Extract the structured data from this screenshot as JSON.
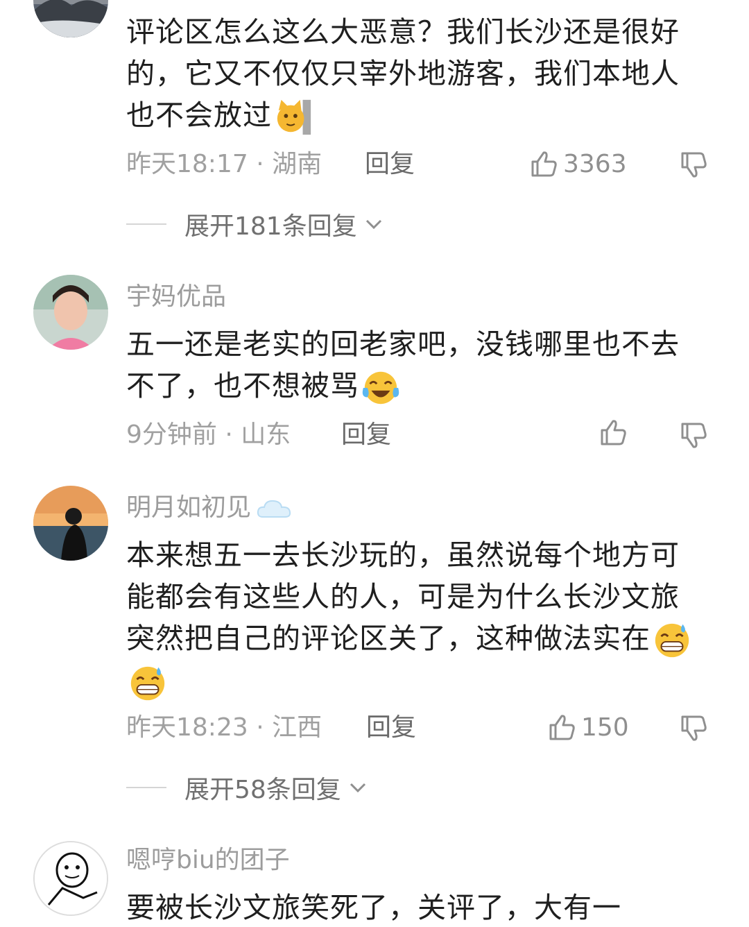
{
  "comments": [
    {
      "username": "",
      "text": "评论区怎么这么大恶意？我们长沙还是很好的，它又不仅仅只宰外地游客，我们本地人也不会放过",
      "emoji": [
        "cat-peek-emoji"
      ],
      "time": "昨天18:17 · 湖南",
      "reply": "回复",
      "likes": "3363",
      "expand": "展开181条回复"
    },
    {
      "username": "宇妈优品",
      "text": "五一还是老实的回老家吧，没钱哪里也不去不了，也不想被骂",
      "emoji": [
        "tears-of-joy-emoji"
      ],
      "time": "9分钟前 · 山东",
      "reply": "回复",
      "likes": ""
    },
    {
      "username": "明月如初见",
      "text": "本来想五一去长沙玩的，虽然说每个地方可能都会有这些人的人，可是为什么长沙文旅突然把自己的评论区关了，这种做法实在",
      "emoji": [
        "sweat-smile-emoji",
        "sweat-smile-emoji"
      ],
      "time": "昨天18:23 · 江西",
      "reply": "回复",
      "likes": "150",
      "expand": "展开58条回复"
    },
    {
      "username": "嗯哼biu的团子",
      "text": "要被长沙文旅笑死了，关评了，大有一"
    }
  ],
  "colors": {
    "muted": "#9c9c9c",
    "text": "#1f1f1f",
    "reply": "#6a6a6a"
  }
}
